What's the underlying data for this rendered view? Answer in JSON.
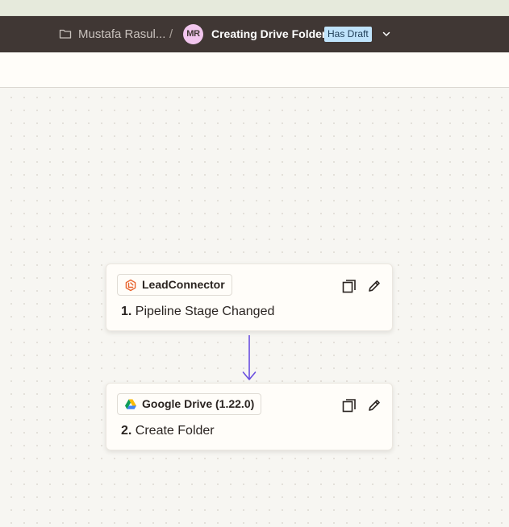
{
  "header": {
    "folder_name": "Mustafa Rasul...",
    "separator": "/",
    "avatar_initials": "MR",
    "zap_title": "Creating Drive Folder",
    "draft_badge": "Has Draft"
  },
  "steps": [
    {
      "number": "1.",
      "title": "Pipeline Stage Changed",
      "app_name": "LeadConnector",
      "app_icon": "leadconnector-icon"
    },
    {
      "number": "2.",
      "title": "Create Folder",
      "app_name": "Google Drive (1.22.0)",
      "app_icon": "google-drive-icon"
    }
  ],
  "colors": {
    "header_bg": "#403734",
    "badge_bg": "#bfe3fb",
    "avatar_bg": "#f2c6ee",
    "connector": "#6a4fe0",
    "leadconnector_orange": "#e8622c"
  }
}
